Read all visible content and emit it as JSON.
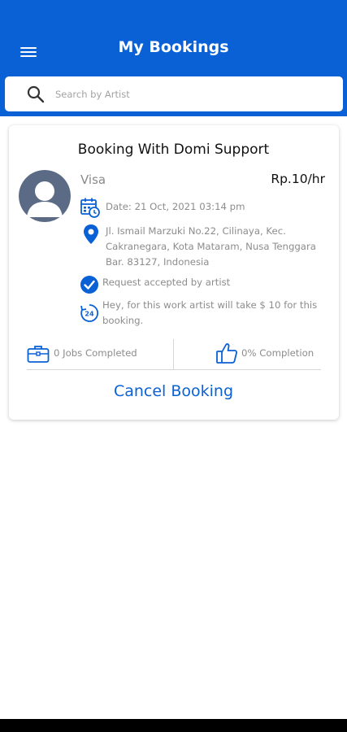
{
  "header": {
    "title": "My Bookings",
    "background": "#0a61d6",
    "menu_icon": "hamburger-menu-icon"
  },
  "search": {
    "placeholder": "Search by Artist",
    "icon": "search-icon"
  },
  "booking": {
    "title": "Booking With Domi Support",
    "artist_name": "Visa",
    "rate": "Rp.10/hr",
    "date": "Date: 21 Oct, 2021 03:14 pm",
    "address": "Jl. Ismail Marzuki No.22, Cilinaya, Kec. Cakranegara, Kota Mataram, Nusa Tenggara Bar. 83127, Indonesia",
    "status": "Request accepted by artist",
    "note": "Hey, for this work artist will take $ 10 for this booking.",
    "jobs_completed": "0 Jobs Completed",
    "completion": "0% Completion",
    "cancel_label": "Cancel Booking"
  },
  "accent_color": "#0a61d6"
}
